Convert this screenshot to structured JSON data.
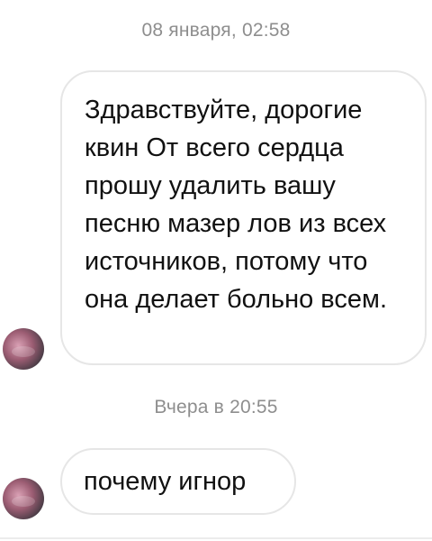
{
  "conversation": {
    "messages": [
      {
        "timestamp": "08 января, 02:58",
        "text": "Здравствуйте, дорогие\nквин От всего сердца\nпрошу удалить вашу\nпесню мазер лов из всех\nисточников, потому что\nона делает больно  всем."
      },
      {
        "timestamp": "Вчера в 20:55",
        "text": "почему игнор"
      }
    ]
  },
  "colors": {
    "timestamp": "#8e8e8e",
    "bubble_border": "#e6e6e6",
    "text": "#111111"
  }
}
